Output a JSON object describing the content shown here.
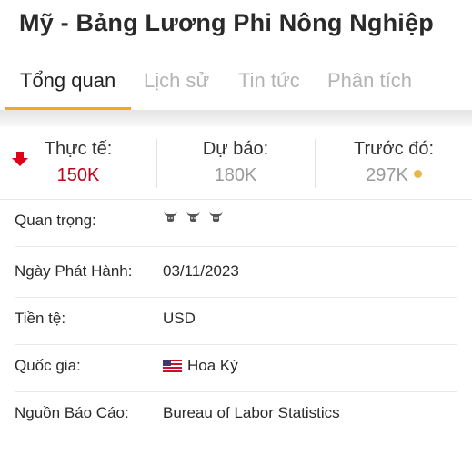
{
  "header": {
    "title": "Mỹ - Bảng Lương Phi Nông Nghiệp"
  },
  "tabs": [
    {
      "label": "Tổng quan",
      "active": true
    },
    {
      "label": "Lịch sử",
      "active": false
    },
    {
      "label": "Tin tức",
      "active": false
    },
    {
      "label": "Phân tích",
      "active": false
    }
  ],
  "summary": {
    "actual": {
      "label": "Thực tế:",
      "value": "150K",
      "color": "#c0001a"
    },
    "forecast": {
      "label": "Dự báo:",
      "value": "180K",
      "color": "#9a9a9a"
    },
    "previous": {
      "label": "Trước đó:",
      "value": "297K",
      "color": "#9a9a9a"
    }
  },
  "details": {
    "importance": {
      "label": "Quan trọng:",
      "level": 3,
      "max": 3
    },
    "release_date": {
      "label": "Ngày Phát Hành:",
      "value": "03/11/2023"
    },
    "currency": {
      "label": "Tiền tệ:",
      "value": "USD"
    },
    "country": {
      "label": "Quốc gia:",
      "value": "Hoa Kỳ",
      "flag": "us-flag-icon"
    },
    "source": {
      "label": "Nguồn Báo Cáo:",
      "value": "Bureau of Labor Statistics"
    }
  },
  "colors": {
    "accent": "#f5a623",
    "down": "#e0001a",
    "link": "#1f4e8c"
  }
}
